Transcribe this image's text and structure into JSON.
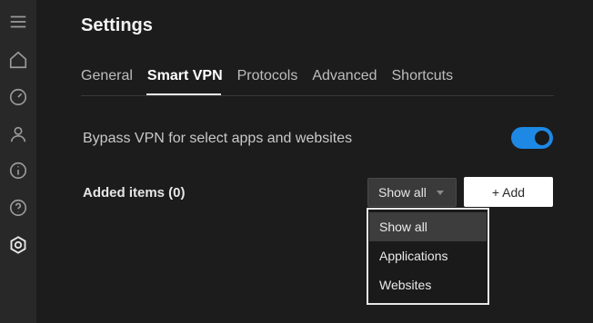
{
  "sidebar": {
    "items": [
      {
        "icon": "menu-icon"
      },
      {
        "icon": "home-icon"
      },
      {
        "icon": "speedometer-icon"
      },
      {
        "icon": "user-icon"
      },
      {
        "icon": "info-icon"
      },
      {
        "icon": "help-icon"
      },
      {
        "icon": "settings-icon",
        "active": true
      }
    ]
  },
  "header": {
    "title": "Settings"
  },
  "tabs": [
    {
      "label": "General"
    },
    {
      "label": "Smart VPN",
      "active": true
    },
    {
      "label": "Protocols"
    },
    {
      "label": "Advanced"
    },
    {
      "label": "Shortcuts"
    }
  ],
  "smart_vpn": {
    "bypass_label": "Bypass VPN for select apps and websites",
    "bypass_enabled": true,
    "added_items_label": "Added items (0)",
    "filter_selected": "Show all",
    "add_button_label": "+ Add",
    "filter_options": [
      "Show all",
      "Applications",
      "Websites"
    ]
  },
  "colors": {
    "background": "#1c1c1c",
    "sidebar": "#282828",
    "toggle_on": "#1e88e5"
  }
}
